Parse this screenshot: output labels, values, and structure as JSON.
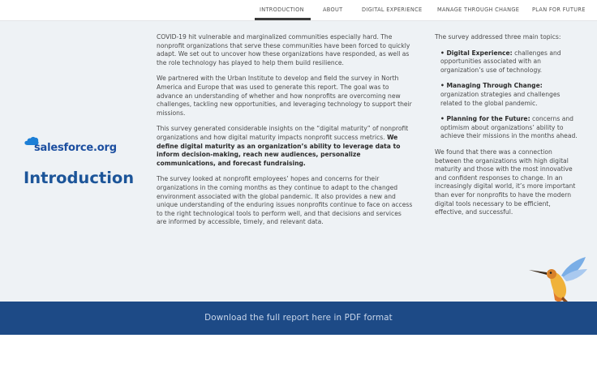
{
  "nav": {
    "items": [
      {
        "label": "INTRODUCTION",
        "active": true
      },
      {
        "label": "ABOUT",
        "active": false
      },
      {
        "label": "DIGITAL EXPERIENCE",
        "active": false
      },
      {
        "label": "MANAGE THROUGH CHANGE",
        "active": false
      },
      {
        "label": "PLAN FOR FUTURE",
        "active": false
      }
    ]
  },
  "brand": {
    "logo_text": "salesforce.org",
    "color": "#1c4fa0"
  },
  "page": {
    "title": "Introduction",
    "title_color": "#1c5599"
  },
  "middle": {
    "p1": "COVID-19 hit vulnerable and marginalized communities especially hard. The nonprofit organizations that serve these communities have been forced to quickly adapt. We set out to uncover how these organizations have responded, as well as the role technology has played to help them build resilience.",
    "p2": "We partnered with the Urban Institute to develop and field the survey in North America and Europe that was used to generate this report. The goal was to advance an understanding of whether and how nonprofits are overcoming new challenges, tackling new opportunities, and leveraging technology to support their missions.",
    "p3_a": "This survey generated considerable insights on the “digital maturity” of nonprofit organizations and how digital maturity impacts nonprofit success metrics. ",
    "p3_b": "We define digital maturity as an organization’s ability to leverage data to inform decision-making, reach new audiences, personalize communications, and forecast fundraising.",
    "p4": "The survey looked at nonprofit employees’ hopes and concerns for their organizations in the coming months as they continue to adapt to the changed environment associated with the global pandemic. It also provides a new and unique understanding of the enduring issues nonprofits continue to face on access to the right technological tools to perform well, and that decisions and services are informed by accessible, timely, and relevant data."
  },
  "right": {
    "intro": "The survey addressed three main topics:",
    "topics": [
      {
        "title": "• Digital Experience:",
        "text": " challenges and opportunities associated with an organization’s use of technology."
      },
      {
        "title": "• Managing Through Change:",
        "text": " organization strategies and challenges related to the global pandemic."
      },
      {
        "title": "• Planning for the Future:",
        "text": " concerns and optimism about organizations’ ability to achieve their missions in the months ahead."
      }
    ],
    "conclusion": "We found that there was a connection between the organizations with high digital maturity and those with the most innovative and confident responses to change. In an increasingly digital world, it’s more important than ever for nonprofits to have the modern digital tools necessary to be efficient, effective, and successful."
  },
  "download": {
    "label": "Download the full report here in PDF format",
    "band_color": "#1d4a86"
  },
  "colors": {
    "background": "#eef2f5",
    "accent": "#1c5599"
  }
}
